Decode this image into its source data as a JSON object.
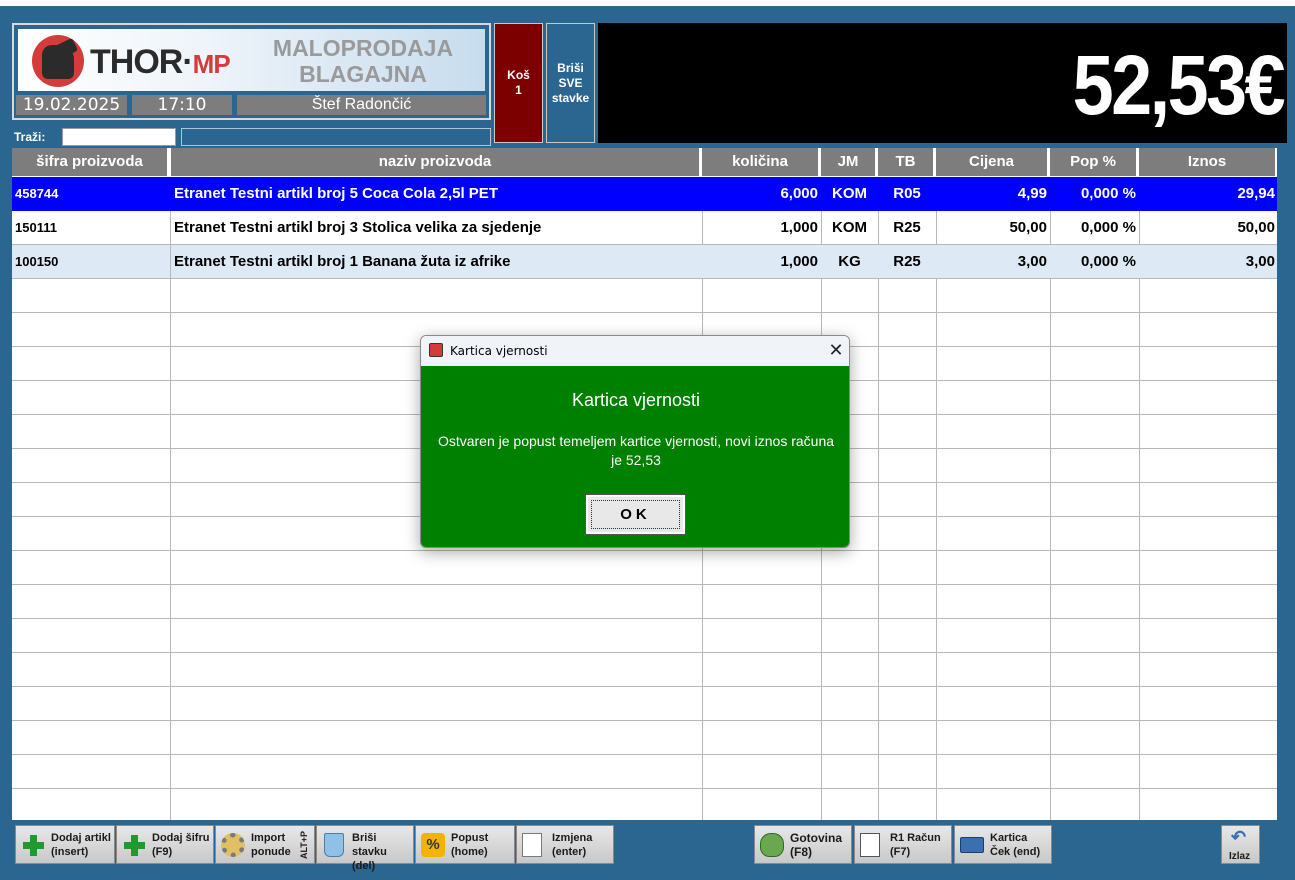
{
  "window": {
    "top_strip_color": "#ffffff",
    "background_color": "#2a6690"
  },
  "header": {
    "logo_text_main": "THOR·",
    "logo_text_mp": "MP",
    "app_title_line1": "MALOPRODAJA",
    "app_title_line2": "BLAGAJNA",
    "date": "19.02.2025",
    "time": "17:10",
    "user": "Štef Radončić"
  },
  "buttons": {
    "kos_line1": "Koš",
    "kos_line2": "1",
    "brisi_sve_line1": "Briši",
    "brisi_sve_line2": "SVE",
    "brisi_sve_line3": "stavke"
  },
  "total": {
    "value": "52,53€"
  },
  "search": {
    "label": "Traži:",
    "value": "",
    "secondary_value": ""
  },
  "table": {
    "columns": [
      {
        "key": "sifra",
        "label": "šifra proizvoda"
      },
      {
        "key": "naziv",
        "label": "naziv proizvoda"
      },
      {
        "key": "kolicina",
        "label": "količina"
      },
      {
        "key": "jm",
        "label": "JM"
      },
      {
        "key": "tb",
        "label": "TB"
      },
      {
        "key": "cijena",
        "label": "Cijena"
      },
      {
        "key": "pop",
        "label": "Pop %"
      },
      {
        "key": "iznos",
        "label": "Iznos"
      }
    ],
    "rows": [
      {
        "sifra": "458744",
        "naziv": "Etranet Testni artikl broj 5 Coca Cola 2,5l PET",
        "kolicina": "6,000",
        "jm": "KOM",
        "tb": "R05",
        "cijena": "4,99",
        "pop": "0,000 %",
        "iznos": "29,94",
        "selected": true
      },
      {
        "sifra": "150111",
        "naziv": "Etranet Testni artikl broj 3 Stolica velika za sjedenje",
        "kolicina": "1,000",
        "jm": "KOM",
        "tb": "R25",
        "cijena": "50,00",
        "pop": "0,000 %",
        "iznos": "50,00",
        "selected": false
      },
      {
        "sifra": "100150",
        "naziv": "Etranet Testni artikl broj 1 Banana žuta iz afrike",
        "kolicina": "1,000",
        "jm": "KG",
        "tb": "R25",
        "cijena": "3,00",
        "pop": "0,000 %",
        "iznos": "3,00",
        "selected": false
      }
    ]
  },
  "toolbar": {
    "dodaj_artikl_l1": "Dodaj artikl",
    "dodaj_artikl_l2": "(insert)",
    "dodaj_sifru_l1": "Dodaj šifru",
    "dodaj_sifru_l2": "(F9)",
    "import_l1": "Import",
    "import_l2": "ponude",
    "import_shortcut": "ALT+P",
    "brisi_stavku_l1": "Briši",
    "brisi_stavku_l2": "stavku (del)",
    "popust_l1": "Popust",
    "popust_l2": "(home)",
    "izmjena_l1": "Izmjena",
    "izmjena_l2": "(enter)",
    "gotovina_l1": "Gotovina",
    "gotovina_l2": "(F8)",
    "r1_racun_l1": "R1 Račun",
    "r1_racun_l2": "(F7)",
    "kartica_l1": "Kartica",
    "kartica_l2": "Ček (end)",
    "izlaz": "Izlaz"
  },
  "dialog": {
    "window_title": "Kartica vjernosti",
    "heading": "Kartica vjernosti",
    "message": "Ostvaren je popust temeljem kartice vjernosti, novi iznos računa je 52,53",
    "ok_label": "OK",
    "background_color": "#008000"
  }
}
